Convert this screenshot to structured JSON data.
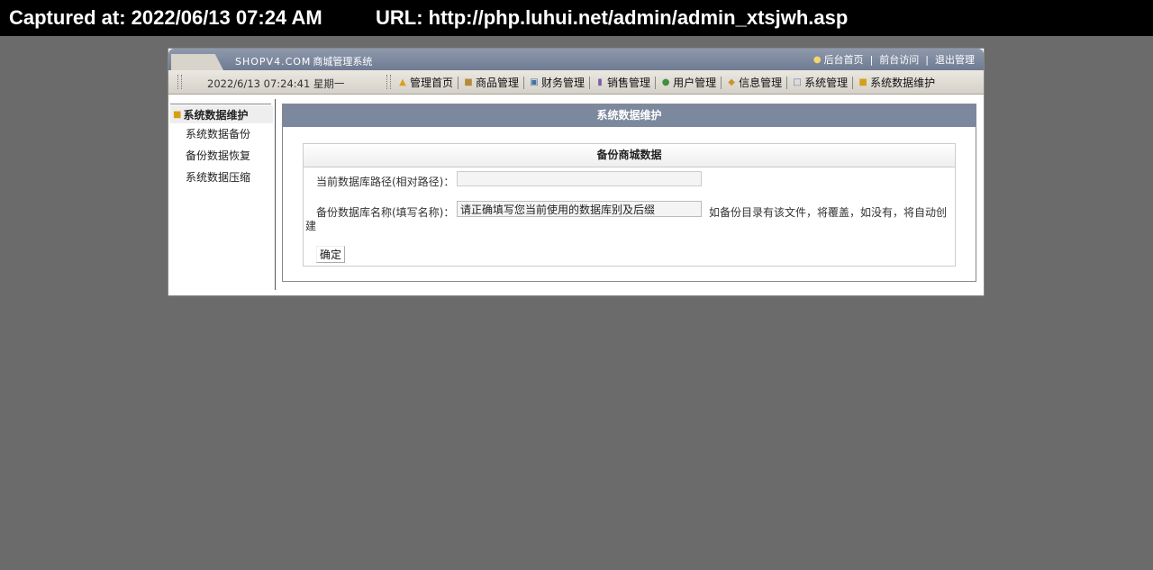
{
  "capture": {
    "time": "Captured at: 2022/06/13 07:24 AM",
    "url": "URL: http://php.luhui.net/admin/admin_xtsjwh.asp"
  },
  "header": {
    "brand": "SHOPV4.COM",
    "brand_sub": "商城管理系统",
    "links": [
      "后台首页",
      "前台访问",
      "退出管理"
    ],
    "datetime": "2022/6/13 07:24:41 星期一",
    "menu": [
      {
        "label": "管理首页",
        "icon": "trophy-icon"
      },
      {
        "label": "商品管理",
        "icon": "box-icon"
      },
      {
        "label": "财务管理",
        "icon": "monitor-icon"
      },
      {
        "label": "销售管理",
        "icon": "chart-icon"
      },
      {
        "label": "用户管理",
        "icon": "user-icon"
      },
      {
        "label": "信息管理",
        "icon": "message-icon"
      },
      {
        "label": "系统管理",
        "icon": "clipboard-icon"
      },
      {
        "label": "系统数据维护",
        "icon": "lock-icon"
      }
    ]
  },
  "sidebar": {
    "title": "系统数据维护",
    "items": [
      "系统数据备份",
      "备份数据恢复",
      "系统数据压缩"
    ]
  },
  "panel": {
    "title": "系统数据维护",
    "section_title": "备份商城数据",
    "path_label": "当前数据库路径(相对路径)：",
    "path_value": "",
    "name_label": "备份数据库名称(填写名称)：",
    "name_value": "请正确填写您当前使用的数据库别及后缀",
    "hint": "如备份目录有该文件，将覆盖，如没有，将自动创",
    "hint_cont": "建",
    "submit_label": "确定"
  }
}
